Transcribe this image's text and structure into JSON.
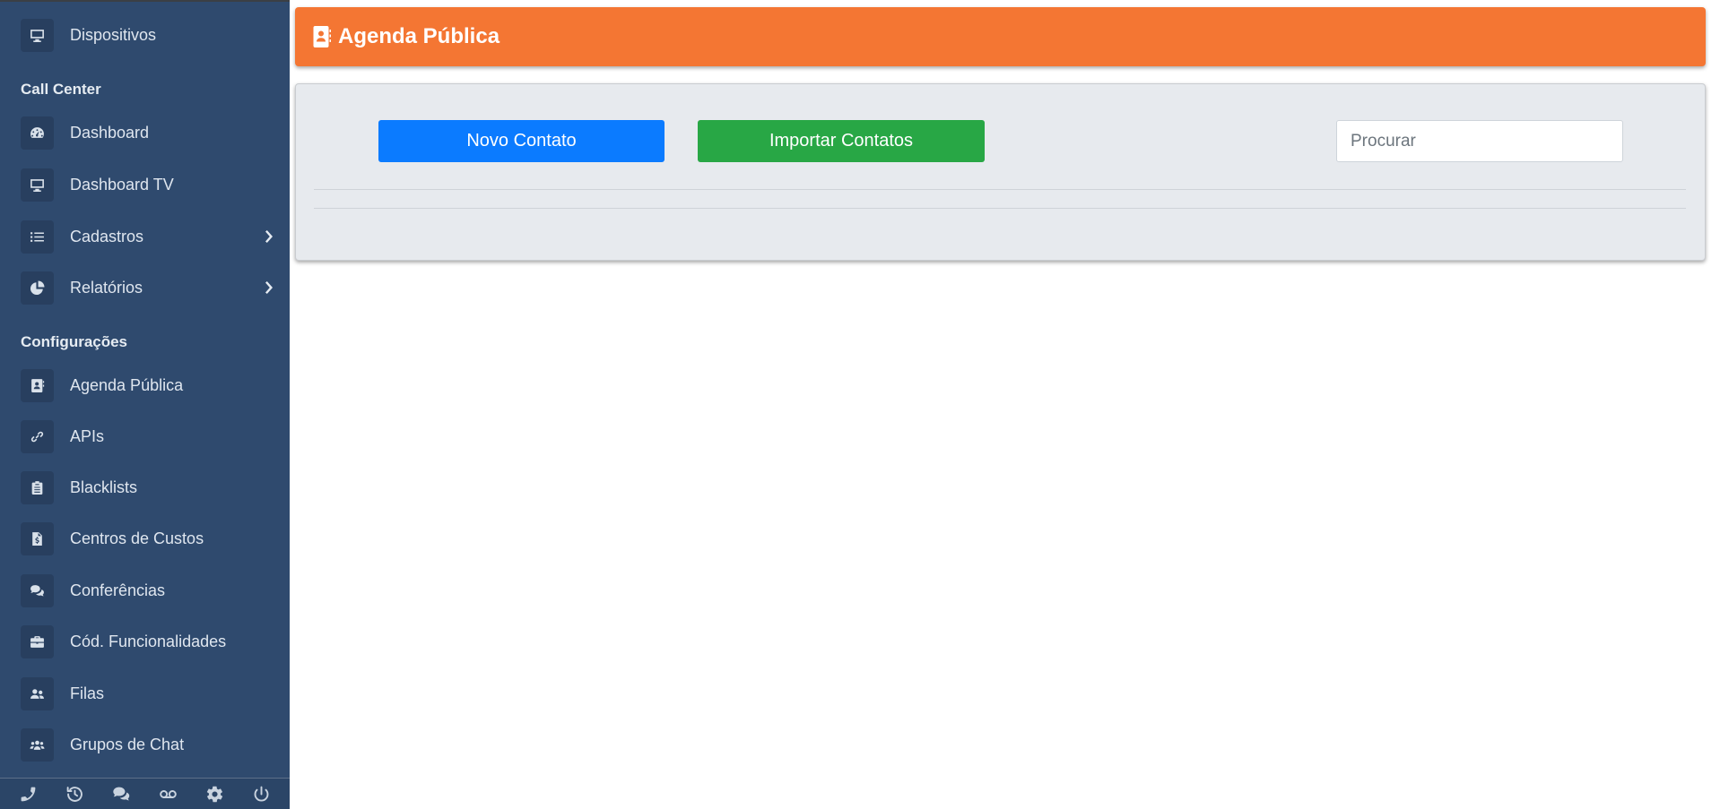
{
  "sidebar": {
    "items": [
      {
        "label": "Dispositivos",
        "icon": "monitor-icon"
      },
      {
        "label": "Dashboard",
        "icon": "tachometer-icon"
      },
      {
        "label": "Dashboard TV",
        "icon": "monitor-icon"
      },
      {
        "label": "Cadastros",
        "icon": "list-icon",
        "has_submenu": true
      },
      {
        "label": "Relatórios",
        "icon": "pie-chart-icon",
        "has_submenu": true
      },
      {
        "label": "Agenda Pública",
        "icon": "address-book-icon"
      },
      {
        "label": "APIs",
        "icon": "link-icon"
      },
      {
        "label": "Blacklists",
        "icon": "clipboard-icon"
      },
      {
        "label": "Centros de Custos",
        "icon": "invoice-dollar-icon"
      },
      {
        "label": "Conferências",
        "icon": "comments-icon"
      },
      {
        "label": "Cód. Funcionalidades",
        "icon": "briefcase-icon"
      },
      {
        "label": "Filas",
        "icon": "user-friends-icon"
      },
      {
        "label": "Grupos de Chat",
        "icon": "users-icon"
      }
    ],
    "sections": {
      "call_center": "Call Center",
      "configuracoes": "Configurações"
    },
    "bottom_bar": [
      "phone-icon",
      "history-icon",
      "comments-icon",
      "voicemail-icon",
      "gear-icon",
      "power-icon"
    ]
  },
  "header": {
    "title": "Agenda Pública",
    "icon": "address-book-icon",
    "color": "#f47633"
  },
  "toolbar": {
    "new_contact_label": "Novo Contato",
    "import_contacts_label": "Importar Contatos",
    "search_placeholder": "Procurar"
  },
  "colors": {
    "sidebar_bg": "#2f4a6e",
    "primary_button": "#0b7bff",
    "success_button": "#28a745",
    "header_accent": "#f47633"
  }
}
